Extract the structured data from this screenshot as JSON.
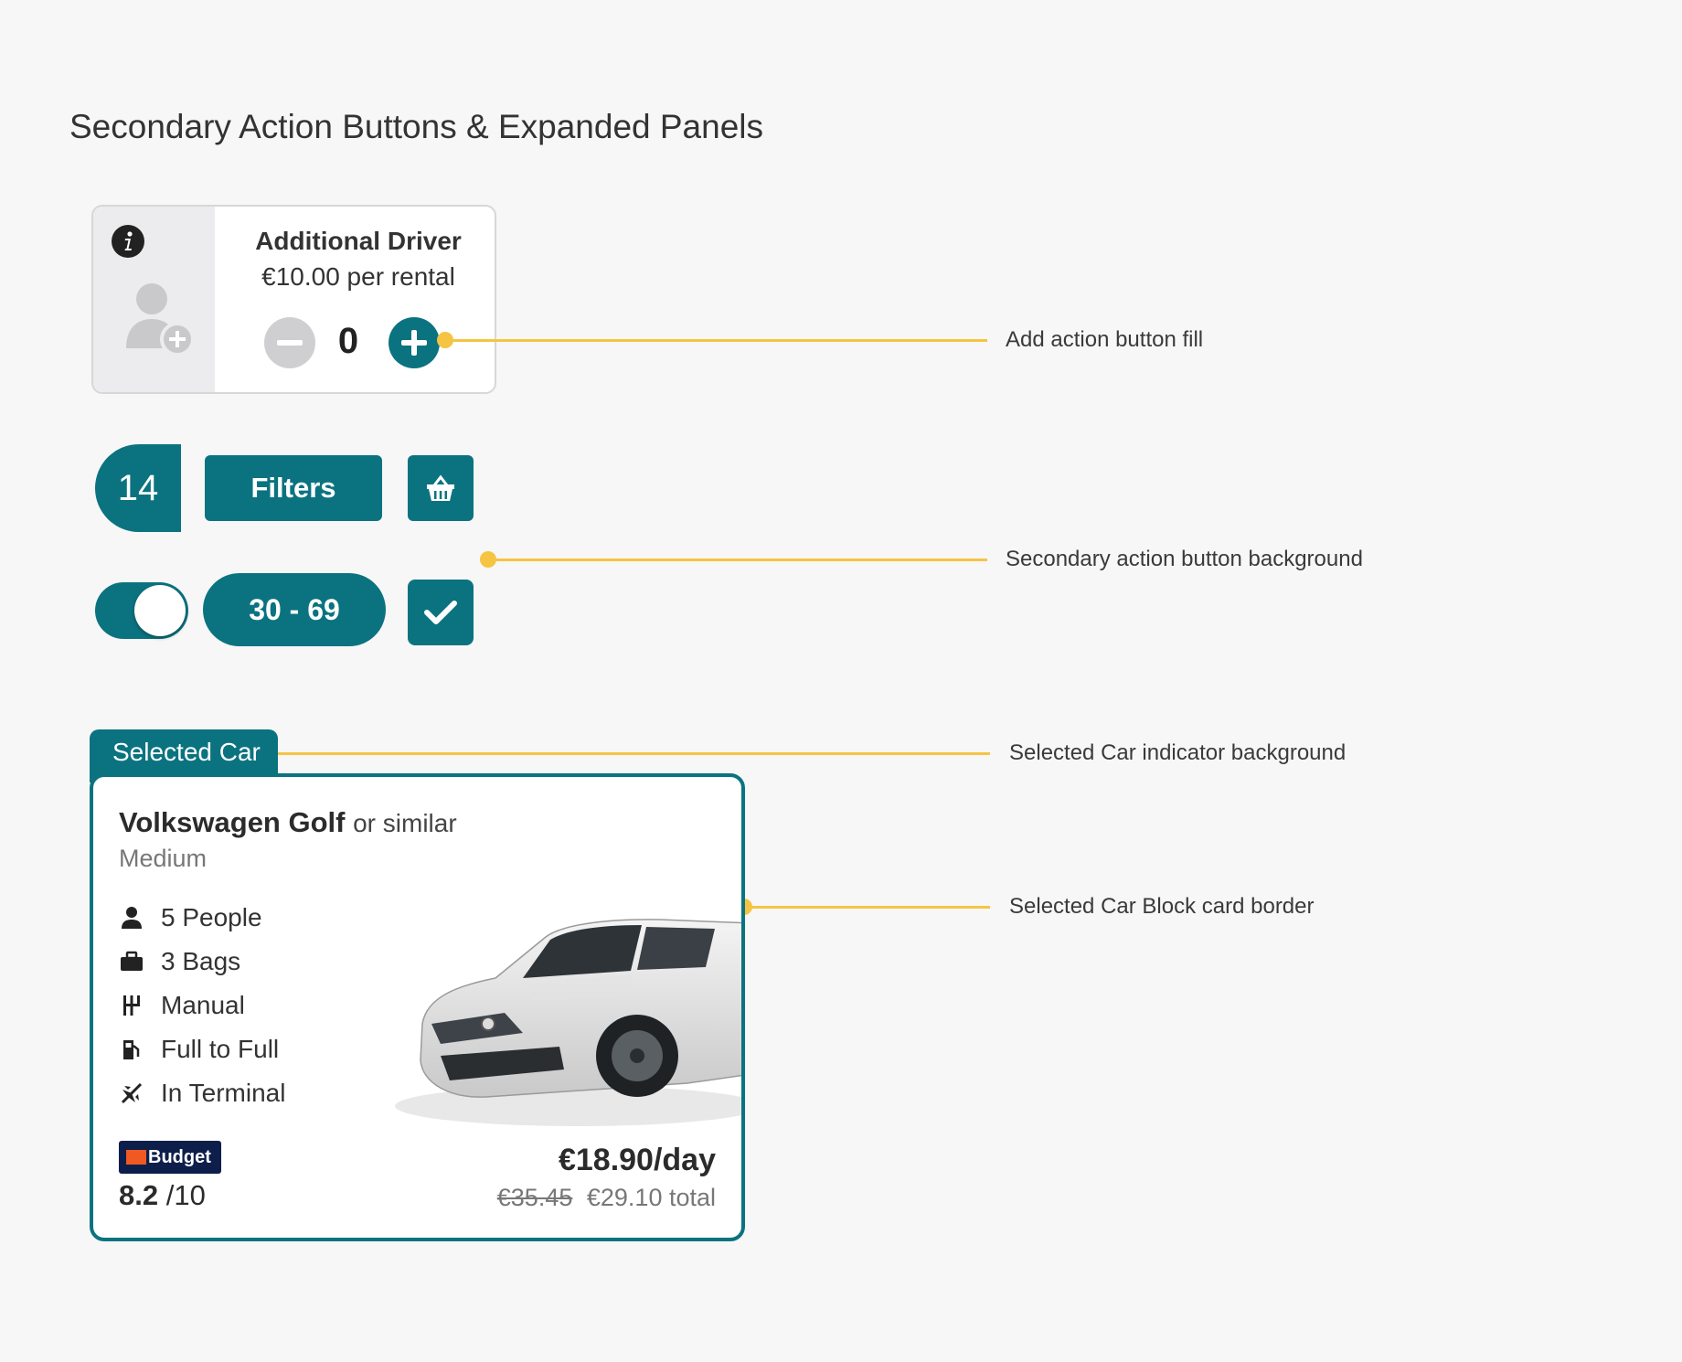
{
  "page": {
    "title": "Secondary Action Buttons & Expanded Panels"
  },
  "colors": {
    "primary_teal": "#0b7380",
    "annotation_yellow": "#f6c443",
    "background": "#f7f7f7"
  },
  "additional_driver": {
    "title": "Additional Driver",
    "price": "€10.00 per rental",
    "count": "0",
    "icons": [
      "info-icon",
      "add-person-icon",
      "minus-icon",
      "plus-icon"
    ]
  },
  "controls": {
    "count_badge": "14",
    "filters_label": "Filters",
    "range_label": "30 - 69",
    "toggle_on": true,
    "icons": [
      "basket-icon",
      "check-icon"
    ]
  },
  "annotations": {
    "add_action": "Add action button fill",
    "secondary_bg": "Secondary action button background",
    "selected_indicator": "Selected Car indicator background",
    "card_border": "Selected Car Block card border"
  },
  "selected_car": {
    "tab_label": "Selected Car",
    "name": "Volkswagen Golf",
    "similar": "or similar",
    "class": "Medium",
    "features": [
      {
        "icon": "person-icon",
        "label": "5 People"
      },
      {
        "icon": "suitcase-icon",
        "label": "3 Bags"
      },
      {
        "icon": "gearshift-icon",
        "label": "Manual"
      },
      {
        "icon": "fuel-icon",
        "label": "Full to Full"
      },
      {
        "icon": "plane-icon",
        "label": "In Terminal"
      }
    ],
    "brand": "Budget",
    "rating": "8.2",
    "rating_scale": "/10",
    "price_per_day": "€18.90/day",
    "old_total": "€35.45",
    "total": "€29.10 total"
  }
}
